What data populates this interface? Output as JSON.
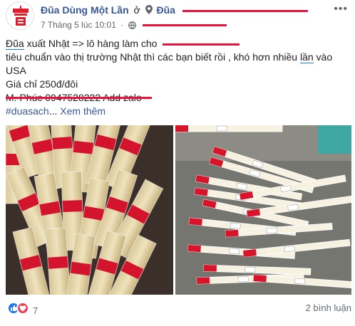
{
  "post": {
    "page_name": "Đũa Dùng Một Lần",
    "at_word": "ở",
    "place_name": "Đũa",
    "timestamp": "7 Tháng 5 lúc 10:01",
    "meta_separator": "·",
    "text": {
      "line1_word_a": "Đũa",
      "line1_rest": " xuất Nhật => lô hàng làm cho",
      "line2_pre": "tiêu chuẩn vào thị trường Nhật thì các bạn biết rồi , khó hơn nhiều ",
      "line2_word": "lần",
      "line2_post": " vào",
      "line3": "USA",
      "line4": "Giá chỉ 250đ/đôi",
      "line5": "M. Phúc 0947528222 Add zalo",
      "hashtag": "#duasach",
      "ellipsis": "...",
      "see_more": "Xem thêm"
    },
    "reaction_count": "7",
    "comments_label": "2 bình luận"
  },
  "icons": {
    "location": "location-pin-icon",
    "audience": "globe-icon",
    "more": "more-options-icon",
    "like": "like-reaction-icon",
    "love": "love-reaction-icon"
  },
  "colors": {
    "link_blue": "#385898",
    "redaction_red": "#e8123a",
    "like_blue": "#1877f2",
    "love_red": "#f33e58",
    "meta_gray": "#616770"
  }
}
